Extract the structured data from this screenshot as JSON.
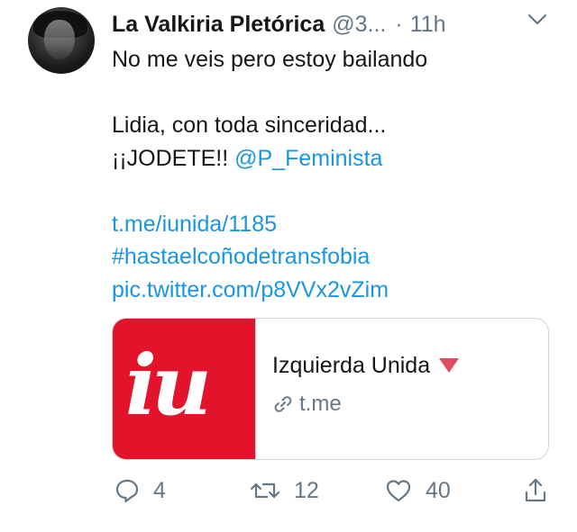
{
  "tweet": {
    "author_name": "La Valkiria Pletórica",
    "author_handle": "@3...",
    "separator": "·",
    "time": "11h",
    "lines": [
      {
        "text": "No me veis pero estoy bailando"
      },
      {
        "text": ""
      },
      {
        "text": "Lidia, con toda sinceridad..."
      },
      {
        "text_prefix": "¡¡JODETE!! ",
        "mention": "@P_Feminista"
      },
      {
        "text": ""
      },
      {
        "link": "t.me/iunida/1185"
      },
      {
        "link": "#hastaelcoñodetransfobia"
      },
      {
        "link": "pic.twitter.com/p8VVx2vZim"
      }
    ]
  },
  "card": {
    "logo_text": "iu",
    "title": "Izquierda Unida",
    "domain": "t.me",
    "logo_color": "#e2132a",
    "triangle_color": "#e04a62"
  },
  "actions": {
    "reply_count": "4",
    "retweet_count": "12",
    "like_count": "40"
  },
  "colors": {
    "link": "#1b95e0",
    "muted": "#657786",
    "text": "#14171a"
  },
  "icons": [
    "chevron-down-icon",
    "link-icon",
    "reply-icon",
    "retweet-icon",
    "like-icon",
    "share-icon"
  ]
}
